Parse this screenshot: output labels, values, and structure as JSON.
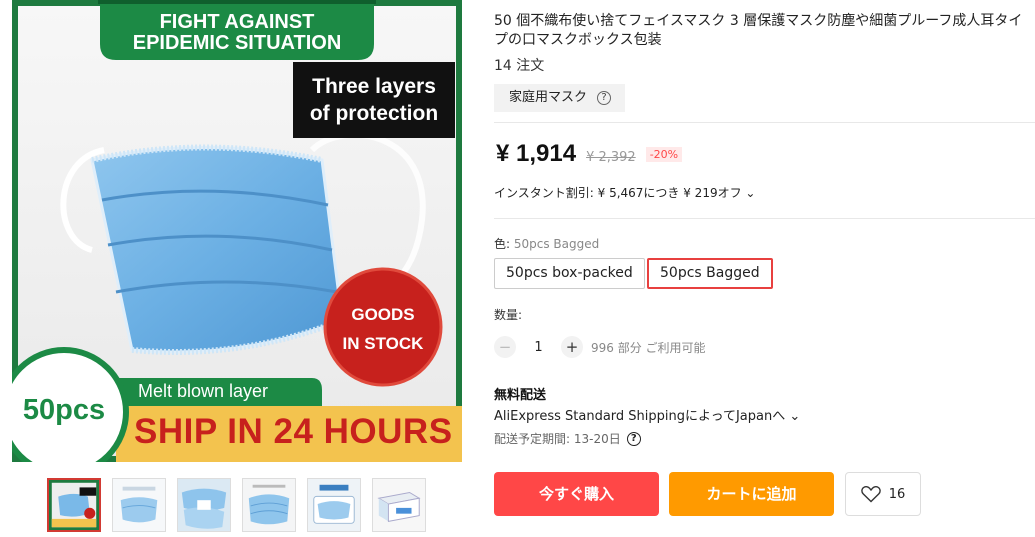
{
  "image": {
    "banner_top": [
      "FIGHT AGAINST",
      "EPIDEMIC SITUATION"
    ],
    "three_layers": [
      "Three layers",
      "of protection"
    ],
    "goods": [
      "GOODS",
      "IN STOCK"
    ],
    "melt": "Melt blown layer",
    "count": "50pcs",
    "ship": "SHIP IN 24 HOURS"
  },
  "product": {
    "title": "50 個不織布使い捨てフェイスマスク 3 層保護マスク防塵や細菌プルーフ成人耳タイプの口マスクボックス包装",
    "orders": "14 注文",
    "tag": "家庭用マスク",
    "help_icon": "?"
  },
  "price": {
    "current": "¥ 1,914",
    "original": "¥ 2,392",
    "discount": "-20%",
    "instant": "インスタント割引: ¥ 5,467につき ¥ 219オフ ⌄"
  },
  "color": {
    "label": "色: ",
    "selected": "50pcs Bagged",
    "options": [
      "50pcs box-packed",
      "50pcs Bagged"
    ]
  },
  "quantity": {
    "label": "数量:",
    "minus": "−",
    "value": "1",
    "plus": "+",
    "available": "996 部分 ご利用可能"
  },
  "shipping": {
    "title": "無料配送",
    "method": "AliExpress Standard ShippingによってJapanへ ⌄",
    "eta": "配送予定期間: 13-20日",
    "help_icon": "?"
  },
  "actions": {
    "buy": "今すぐ購入",
    "cart": "カートに追加",
    "wishlist_count": "16"
  },
  "colors": {
    "accent_red": "#ff4747",
    "cart_orange": "#ff9a00",
    "selected_border": "#e8403f"
  }
}
